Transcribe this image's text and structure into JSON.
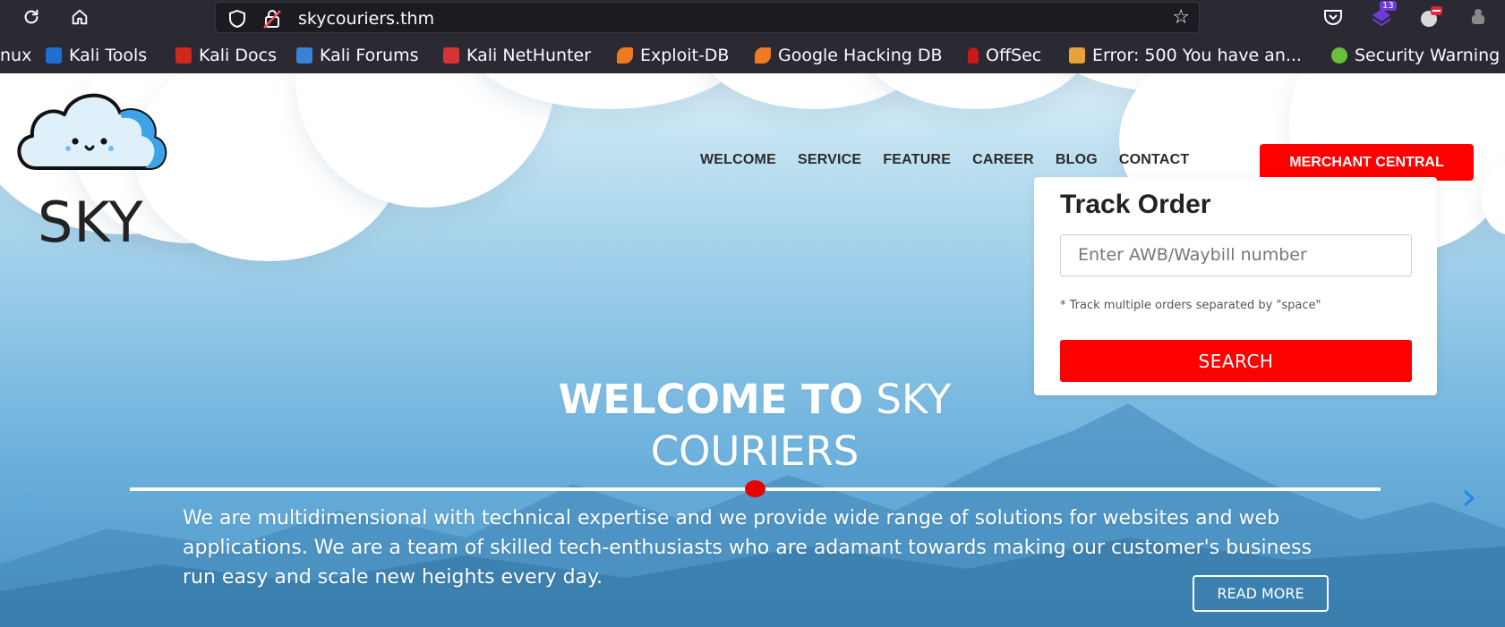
{
  "browser": {
    "url": "skycouriers.thm",
    "extension_badge": "13",
    "bookmarks": [
      {
        "label": "nux",
        "color": "#2b2a33"
      },
      {
        "label": "Kali Tools",
        "color": "#e2553d"
      },
      {
        "label": "Kali Docs",
        "color": "#d1281e"
      },
      {
        "label": "Kali Forums",
        "color": "#3a82d6"
      },
      {
        "label": "Kali NetHunter",
        "color": "#d63434"
      },
      {
        "label": "Exploit-DB",
        "color": "#f07a22"
      },
      {
        "label": "Google Hacking DB",
        "color": "#f07a22"
      },
      {
        "label": "OffSec",
        "color": "#c91a1a"
      },
      {
        "label": "Error: 500 You have an...",
        "color": "#e8a23a"
      },
      {
        "label": "Security Warning",
        "color": "#6bbf3a"
      }
    ]
  },
  "site": {
    "logo_text": "SKY",
    "nav": [
      "WELCOME",
      "SERVICE",
      "FEATURE",
      "CAREER",
      "BLOG",
      "CONTACT"
    ],
    "merchant_button": "MERCHANT CENTRAL",
    "track": {
      "title": "Track Order",
      "placeholder": "Enter AWB/Waybill number",
      "note": "* Track multiple orders separated by \"space\"",
      "button": "SEARCH"
    },
    "hero": {
      "title_bold": "WELCOME TO",
      "title_light_1": "SKY",
      "title_light_2": "COURIERS",
      "text": "We are multidimensional with technical expertise and we provide wide range of solutions for websites and web applications. We are a team of skilled tech-enthusiasts who are adamant towards making our customer's business run easy and scale new heights every day.",
      "read_more": "READ MORE"
    },
    "colors": {
      "accent": "#ff0000",
      "arrow": "#1e88e5"
    }
  }
}
